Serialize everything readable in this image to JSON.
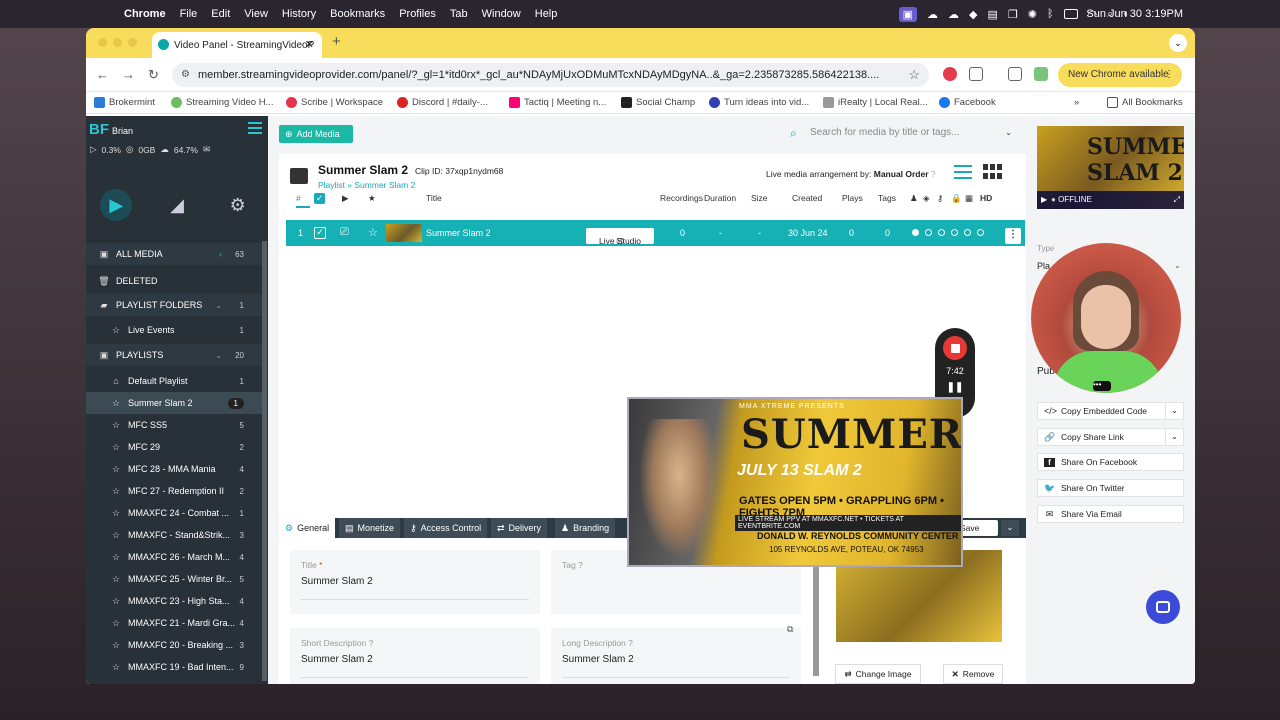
{
  "menubar": {
    "app": "Chrome",
    "items": [
      "File",
      "Edit",
      "View",
      "History",
      "Bookmarks",
      "Profiles",
      "Tab",
      "Window",
      "Help"
    ],
    "clock": "Sun Jun 30  3:19PM"
  },
  "browser": {
    "tab_title": "Video Panel - StreamingVideoP",
    "url": "member.streamingvideoprovider.com/panel/?_gl=1*itd0rx*_gcl_au*NDAyMjUxODMuMTcxNDAyMDgyNA..&_ga=2.235873285.586422138....",
    "new_chrome": "New Chrome available",
    "bookmarks": [
      "Brokermint",
      "Streaming Video H...",
      "Scribe | Workspace",
      "Discord | #daily-...",
      "Tactiq | Meeting n...",
      "Social Champ",
      "Turn ideas into vid...",
      "iRealty | Local Real...",
      "Facebook"
    ],
    "all_bookmarks": "All Bookmarks"
  },
  "sidebar": {
    "initials": "BF",
    "user": "Brian",
    "stat_cpu": "0.3%",
    "stat_storage": "0GB",
    "stat_cloud": "64.7%",
    "all_media": {
      "label": "ALL MEDIA",
      "count": "63"
    },
    "deleted": "DELETED",
    "playlist_folders": {
      "label": "PLAYLIST FOLDERS",
      "count": "1"
    },
    "live_events": {
      "label": "Live Events",
      "count": "1"
    },
    "playlists": {
      "label": "PLAYLISTS",
      "count": "20"
    },
    "items": [
      {
        "label": "Default Playlist",
        "count": "1"
      },
      {
        "label": "Summer Slam 2",
        "count": "1"
      },
      {
        "label": "MFC SS5",
        "count": "5"
      },
      {
        "label": "MFC 29",
        "count": "2"
      },
      {
        "label": "MFC 28 - MMA Mania",
        "count": "4"
      },
      {
        "label": "MFC 27 - Redemption II",
        "count": "2"
      },
      {
        "label": "MMAXFC 24 - Combat ...",
        "count": "1"
      },
      {
        "label": "MMAXFC - Stand&Strik...",
        "count": "3"
      },
      {
        "label": "MMAXFC 26 - March M...",
        "count": "4"
      },
      {
        "label": "MMAXFC 25 - Winter Br...",
        "count": "5"
      },
      {
        "label": "MMAXFC 23 - High Sta...",
        "count": "4"
      },
      {
        "label": "MMAXFC 21 - Mardi Gra...",
        "count": "4"
      },
      {
        "label": "MMAXFC 20 - Breaking ...",
        "count": "3"
      },
      {
        "label": "MMAXFC 19 - Bad Inten...",
        "count": "9"
      }
    ]
  },
  "main": {
    "add_media": "Add Media",
    "search_placeholder": "Search for media by title or tags...",
    "title": "Summer Slam 2",
    "clip_id": "Clip ID: 37xqp1nydm68",
    "crumb_playlist": "Playlist",
    "crumb_item": "Summer Slam 2",
    "arrangement_label": "Live media arrangement by:",
    "arrangement_value": "Manual Order",
    "columns": {
      "num": "#",
      "title": "Title",
      "recordings": "Recordings",
      "duration": "Duration",
      "size": "Size",
      "created": "Created",
      "plays": "Plays",
      "tags": "Tags",
      "hd": "HD"
    },
    "row": {
      "num": "1",
      "title": "Summer Slam 2",
      "live_studio": "Live Studio",
      "recordings": "0",
      "duration": "-",
      "size": "-",
      "created": "30 Jun 24",
      "plays": "0",
      "tags": "0"
    },
    "recorder": {
      "time": "7:42"
    },
    "tabs": [
      "General",
      "Monetize",
      "Access Control",
      "Delivery",
      "Branding"
    ],
    "save": "Save",
    "title_label": "Title",
    "title_value": "Summer Slam 2",
    "tag_label": "Tag",
    "short_desc_label": "Short Description",
    "short_desc_value": "Summer Slam 2",
    "long_desc_label": "Long Description",
    "long_desc_value": "Summer Slam 2",
    "change_image": "Change Image",
    "remove": "Remove"
  },
  "poster": {
    "presents": "MMA XTREME PRESENTS",
    "summer": "SUMMER",
    "date": "JULY 13  SLAM 2",
    "gates": "GATES OPEN 5PM • GRAPPLING 6PM • FIGHTS 7PM",
    "stream": "LIVE STREAM PPV AT MMAXFC.NET • TICKETS AT EVENTBRITE.COM",
    "venue": "DONALD W. REYNOLDS COMMUNITY CENTER",
    "address": "105 REYNOLDS AVE, POTEAU, OK 74953"
  },
  "right": {
    "preview_status": "OFFLINE",
    "preview_text": "SUMMER SLAM 2",
    "type_label": "Type",
    "type_value": "Pla",
    "pub": "Pub",
    "copy_embed": "Copy Embedded Code",
    "copy_share": "Copy Share Link",
    "share_fb": "Share On Facebook",
    "share_tw": "Share On Twitter",
    "share_email": "Share Via Email"
  },
  "colors": {
    "accent": "#16b1b4",
    "sidebar": "#283038",
    "chrome_yellow": "#f8dd5c"
  }
}
